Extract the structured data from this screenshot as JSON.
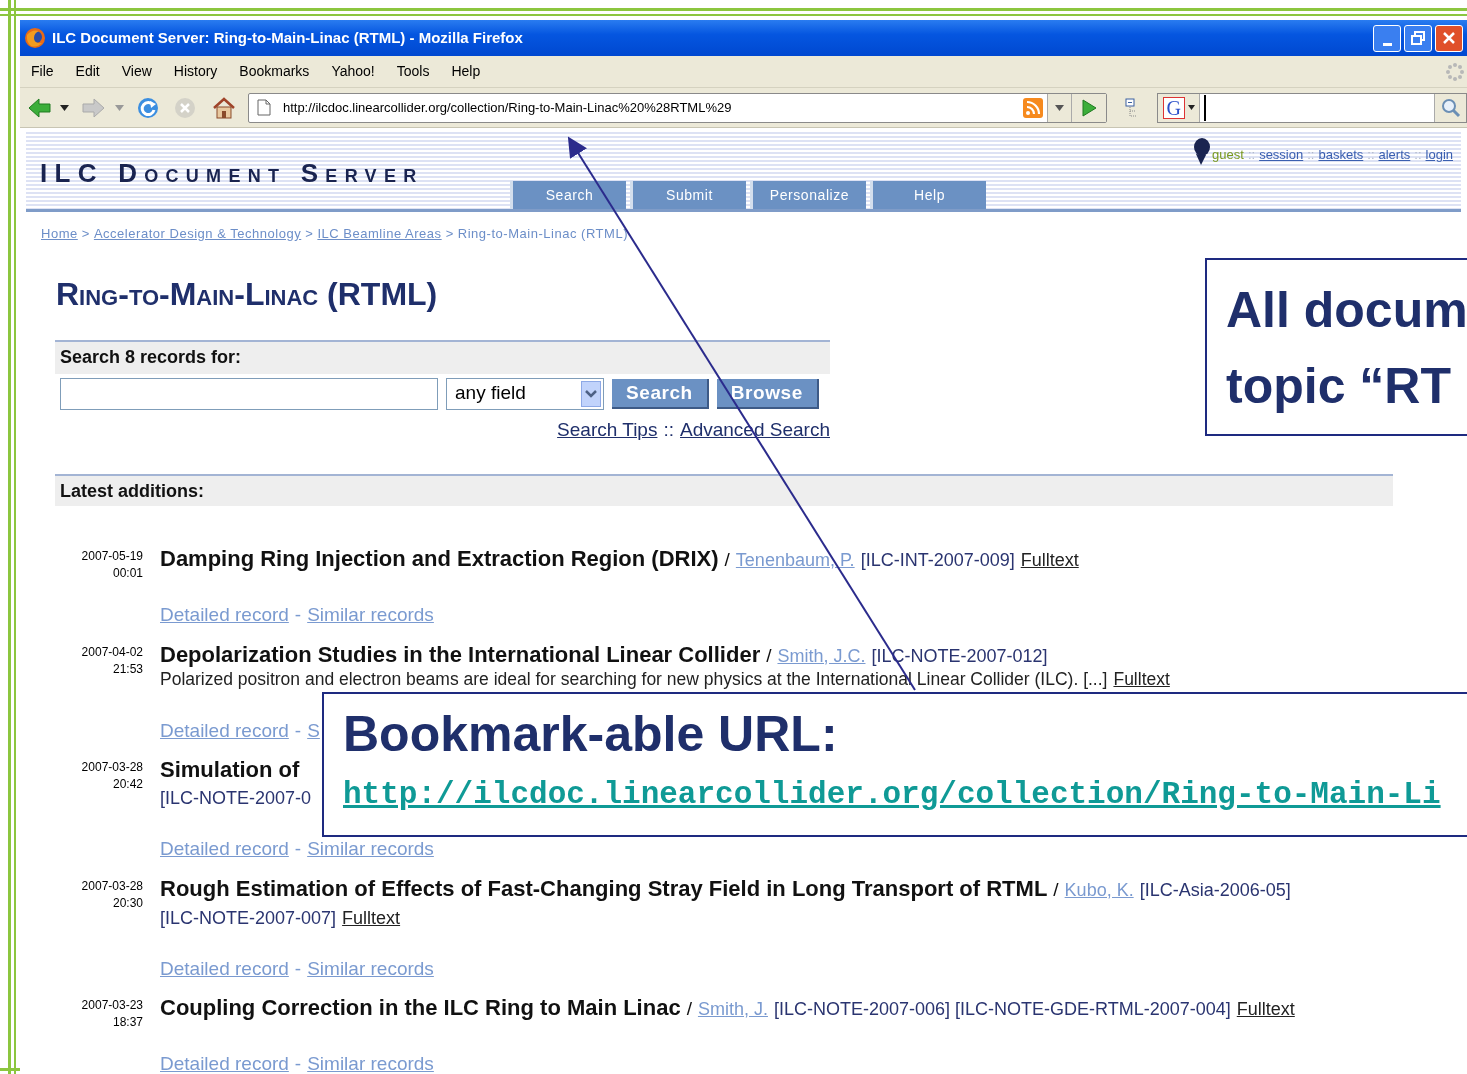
{
  "window": {
    "title": "ILC Document Server: Ring-to-Main-Linac (RTML) - Mozilla Firefox"
  },
  "menu": [
    "File",
    "Edit",
    "View",
    "History",
    "Bookmarks",
    "Yahoo!",
    "Tools",
    "Help"
  ],
  "address_bar": {
    "url": "http://ilcdoc.linearcollider.org/collection/Ring-to-Main-Linac%20%28RTML%29"
  },
  "web_search": {
    "engine_logo": "G"
  },
  "site": {
    "name": "ILC Document Server",
    "user_bar": [
      {
        "label": "guest",
        "link": false
      },
      {
        "label": "session",
        "link": true
      },
      {
        "label": "baskets",
        "link": true
      },
      {
        "label": "alerts",
        "link": true
      },
      {
        "label": "login",
        "link": true
      }
    ],
    "user_bar_separator": "::",
    "tabs": [
      {
        "label": "Search",
        "selected": false
      },
      {
        "label": "Submit",
        "selected": false
      },
      {
        "label": "Personalize",
        "selected": false
      },
      {
        "label": "Help",
        "selected": false
      }
    ]
  },
  "breadcrumb": {
    "separator": ">",
    "items": [
      {
        "label": "Home",
        "link": true
      },
      {
        "label": "Accelerator Design & Technology",
        "link": true
      },
      {
        "label": "ILC Beamline Areas",
        "link": true
      },
      {
        "label": "Ring-to-Main-Linac (RTML)",
        "link": false
      }
    ]
  },
  "heading": "Ring-to-Main-Linac (RTML)",
  "search": {
    "title": "Search 8 records for:",
    "field": "any field",
    "buttons": [
      "Search",
      "Browse"
    ],
    "links": [
      "Search Tips",
      "Advanced Search"
    ],
    "separator": "::"
  },
  "latest": {
    "title": "Latest additions:",
    "link_separator": "-",
    "author_separator": "/",
    "records": [
      {
        "date": "2007-05-19",
        "time": "00:01",
        "title": "Damping Ring Injection and Extraction Region (DRIX)",
        "author": "Tenenbaum, P.",
        "refs": "[ILC-INT-2007-009]",
        "fulltext": "Fulltext",
        "links": [
          "Detailed record",
          "Similar records"
        ]
      },
      {
        "date": "2007-04-02",
        "time": "21:53",
        "title": "Depolarization Studies in the International Linear Collider",
        "author": "Smith, J.C.",
        "refs": "[ILC-NOTE-2007-012]",
        "abstract": "Polarized positron and electron beams are ideal for searching for new physics at the International Linear Collider (ILC). [...]",
        "fulltext": "Fulltext",
        "links": [
          "Detailed record",
          "S"
        ]
      },
      {
        "date": "2007-03-28",
        "time": "20:42",
        "title": "Simulation of",
        "second_line": "[ILC-NOTE-2007-0",
        "links": [
          "Detailed record",
          "Similar records"
        ]
      },
      {
        "date": "2007-03-28",
        "time": "20:30",
        "title": "Rough Estimation of Effects of Fast-Changing Stray Field in Long Transport of RTML",
        "author": "Kubo, K.",
        "refs": "[ILC-Asia-2006-05]",
        "second_line": "[ILC-NOTE-2007-007]",
        "fulltext": "Fulltext",
        "links": [
          "Detailed record",
          "Similar records"
        ]
      },
      {
        "date": "2007-03-23",
        "time": "18:37",
        "title": "Coupling Correction in the ILC Ring to Main Linac",
        "author": "Smith, J.",
        "refs": "[ILC-NOTE-2007-006] [ILC-NOTE-GDE-RTML-2007-004]",
        "fulltext": "Fulltext",
        "links": [
          "Detailed record",
          "Similar records"
        ]
      }
    ]
  },
  "callouts": [
    {
      "lines": [
        "All docum",
        "topic “RT"
      ]
    },
    {
      "title": "Bookmark-able URL:",
      "url": "http://ilcdoc.linearcollider.org/collection/Ring-to-Main-Li"
    }
  ]
}
